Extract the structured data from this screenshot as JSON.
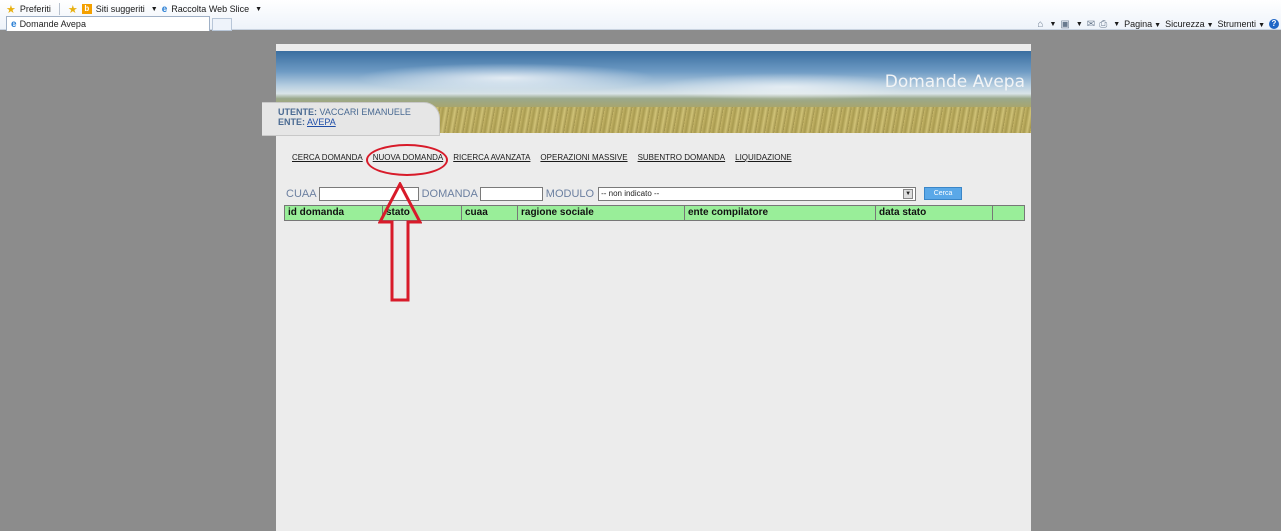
{
  "browser": {
    "favorites_label": "Preferiti",
    "suggested_sites": "Siti suggeriti",
    "web_slice": "Raccolta Web Slice",
    "tab_title": "Domande Avepa",
    "commands": {
      "page": "Pagina",
      "security": "Sicurezza",
      "tools": "Strumenti"
    }
  },
  "app": {
    "title": "Domande Avepa",
    "user_label": "UTENTE:",
    "user_name": "VACCARI EMANUELE",
    "ente_label": "ENTE:",
    "ente_value": "AVEPA"
  },
  "nav": {
    "items": [
      "CERCA DOMANDA",
      "NUOVA DOMANDA",
      "RICERCA AVANZATA",
      "OPERAZIONI MASSIVE",
      "SUBENTRO DOMANDA",
      "LIQUIDAZIONE"
    ]
  },
  "search": {
    "cuaa_label": "CUAA",
    "cuaa_value": "",
    "domanda_label": "DOMANDA",
    "domanda_value": "",
    "modulo_label": "MODULO",
    "modulo_selected": "-- non indicato --",
    "button_label": "Cerca"
  },
  "table": {
    "columns": [
      "id domanda",
      "stato",
      "cuaa",
      "ragione sociale",
      "ente compilatore",
      "data stato"
    ]
  },
  "colors": {
    "header_green": "#99ee99",
    "annotation_red": "#d81b2a",
    "button_blue": "#5aa8e8"
  }
}
